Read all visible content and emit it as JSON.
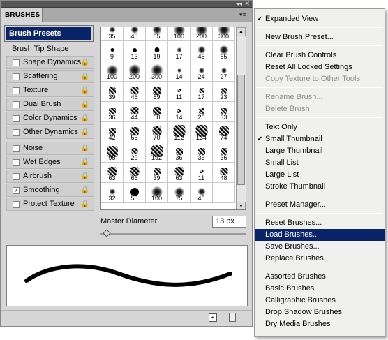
{
  "panel": {
    "tab_label": "BRUSHES",
    "collapse_glyph": "◂◂",
    "close_glyph": "✕",
    "menu_glyph": "▾≡",
    "presets_label": "Brush Presets",
    "tip_shape_label": "Brush Tip Shape",
    "options": [
      {
        "label": "Shape Dynamics",
        "checked": false
      },
      {
        "label": "Scattering",
        "checked": false
      },
      {
        "label": "Texture",
        "checked": false
      },
      {
        "label": "Dual Brush",
        "checked": false
      },
      {
        "label": "Color Dynamics",
        "checked": false
      },
      {
        "label": "Other Dynamics",
        "checked": false
      },
      {
        "label": "Noise",
        "checked": false
      },
      {
        "label": "Wet Edges",
        "checked": false
      },
      {
        "label": "Airbrush",
        "checked": false
      },
      {
        "label": "Smoothing",
        "checked": true
      },
      {
        "label": "Protect Texture",
        "checked": false
      }
    ],
    "check_glyph": "✓",
    "lock_glyph": "🔒",
    "brush_sizes": [
      "35",
      "45",
      "65",
      "100",
      "200",
      "300",
      "9",
      "13",
      "19",
      "17",
      "45",
      "65",
      "100",
      "200",
      "300",
      "14",
      "24",
      "27",
      "39",
      "46",
      "59",
      "11",
      "17",
      "23",
      "36",
      "44",
      "60",
      "14",
      "26",
      "33",
      "42",
      "55",
      "70",
      "112",
      "134",
      "74",
      "95",
      "29",
      "192",
      "36",
      "36",
      "36",
      "63",
      "66",
      "39",
      "63",
      "11",
      "48",
      "32",
      "55",
      "100",
      "75",
      "45",
      ""
    ],
    "master_diameter_label": "Master Diameter",
    "master_diameter_value": "13 px",
    "scroll_up_glyph": "▲",
    "scroll_down_glyph": "▼"
  },
  "menu": {
    "groups": [
      [
        {
          "label": "Expanded View",
          "checked": true
        }
      ],
      [
        {
          "label": "New Brush Preset..."
        }
      ],
      [
        {
          "label": "Clear Brush Controls"
        },
        {
          "label": "Reset All Locked Settings"
        },
        {
          "label": "Copy Texture to Other Tools",
          "disabled": true
        }
      ],
      [
        {
          "label": "Rename Brush...",
          "disabled": true
        },
        {
          "label": "Delete Brush",
          "disabled": true
        }
      ],
      [
        {
          "label": "Text Only"
        },
        {
          "label": "Small Thumbnail",
          "checked": true
        },
        {
          "label": "Large Thumbnail"
        },
        {
          "label": "Small List"
        },
        {
          "label": "Large List"
        },
        {
          "label": "Stroke Thumbnail"
        }
      ],
      [
        {
          "label": "Preset Manager..."
        }
      ],
      [
        {
          "label": "Reset Brushes..."
        },
        {
          "label": "Load Brushes...",
          "highlighted": true
        },
        {
          "label": "Save Brushes..."
        },
        {
          "label": "Replace Brushes..."
        }
      ],
      [
        {
          "label": "Assorted Brushes"
        },
        {
          "label": "Basic Brushes"
        },
        {
          "label": "Calligraphic Brushes"
        },
        {
          "label": "Drop Shadow Brushes"
        },
        {
          "label": "Dry Media Brushes"
        }
      ]
    ],
    "check_glyph": "✔"
  },
  "colors": {
    "selection": "#0a246a"
  }
}
